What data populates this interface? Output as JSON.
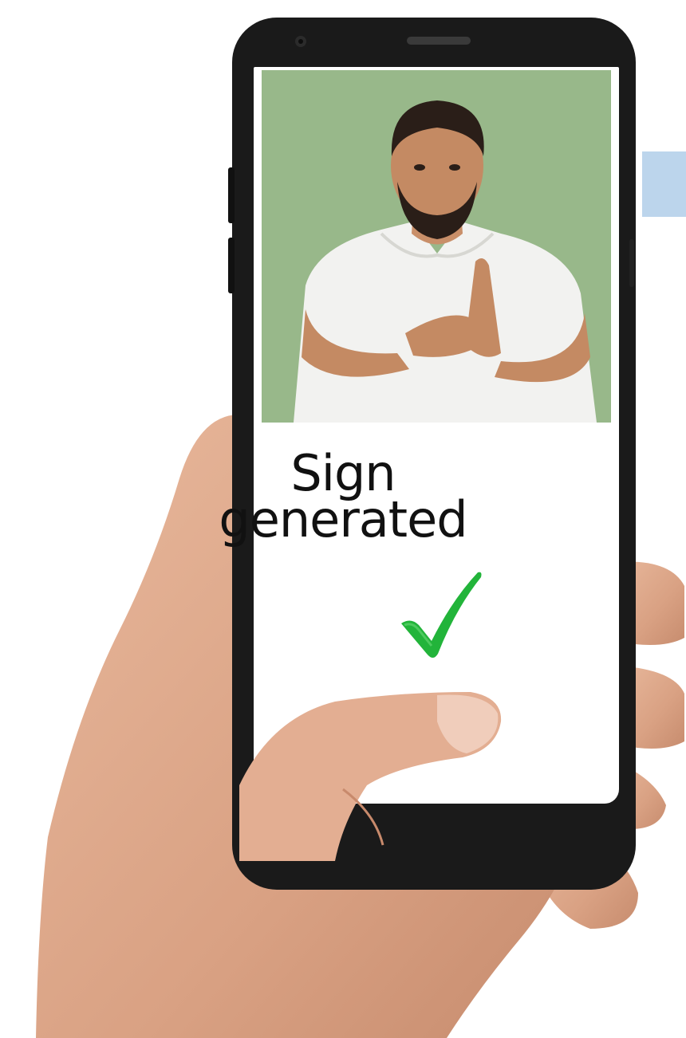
{
  "screen": {
    "caption_line1": "Sign",
    "caption_line2": "generated"
  },
  "icons": {
    "status": "checkmark-icon",
    "status_color": "#22b43a"
  },
  "colors": {
    "photo_background": "#95b687",
    "accent_tab": "#bcd5ec",
    "phone_body": "#1a1a1a"
  }
}
